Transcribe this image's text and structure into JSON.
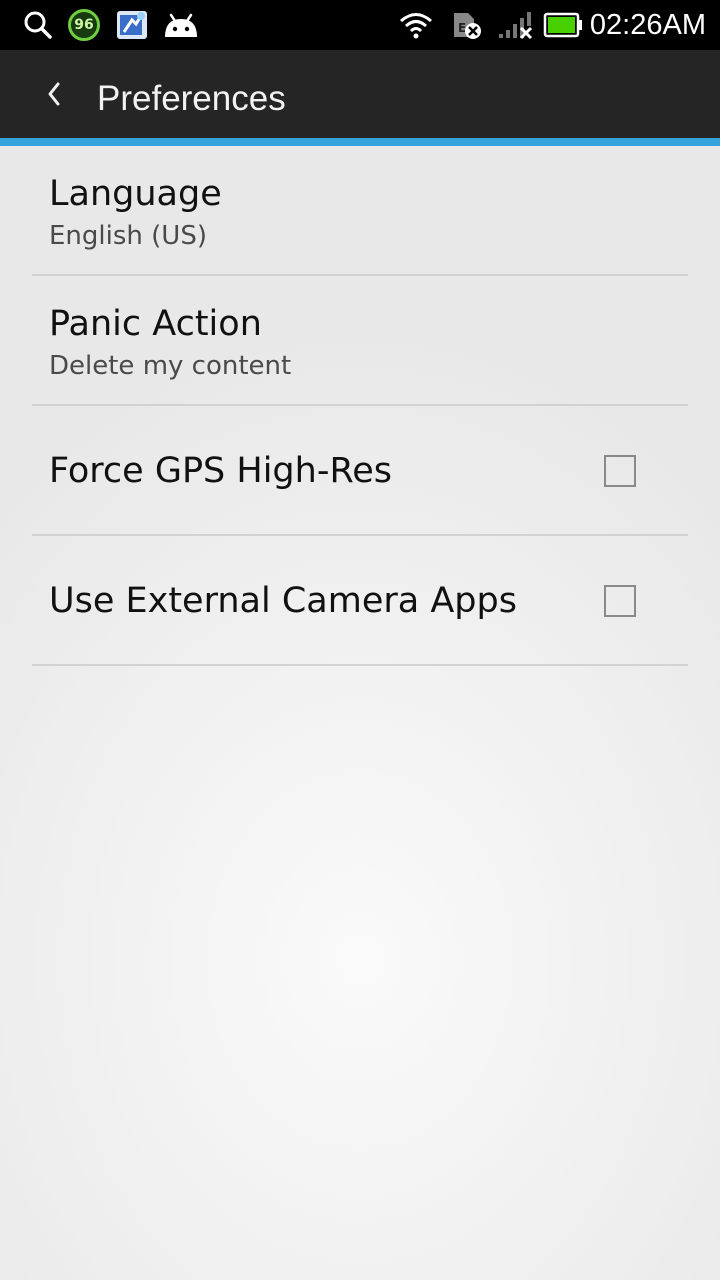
{
  "status_bar": {
    "time": "02:26AM",
    "badge_count": "96",
    "icons": [
      "search-icon",
      "badge-96-icon",
      "tool-app-icon",
      "android-icon",
      "wifi-icon",
      "sim-error-icon",
      "signal-none-icon",
      "battery-icon"
    ],
    "battery_color": "#48d000"
  },
  "action_bar": {
    "title": "Preferences",
    "back_icon": "chevron-left-icon"
  },
  "accent_color": "#35a4dc",
  "preferences": [
    {
      "title": "Language",
      "summary": "English (US)"
    },
    {
      "title": "Panic Action",
      "summary": "Delete my content"
    },
    {
      "title": "Force GPS High-Res",
      "checked": false
    },
    {
      "title": "Use External Camera Apps",
      "checked": false
    }
  ]
}
